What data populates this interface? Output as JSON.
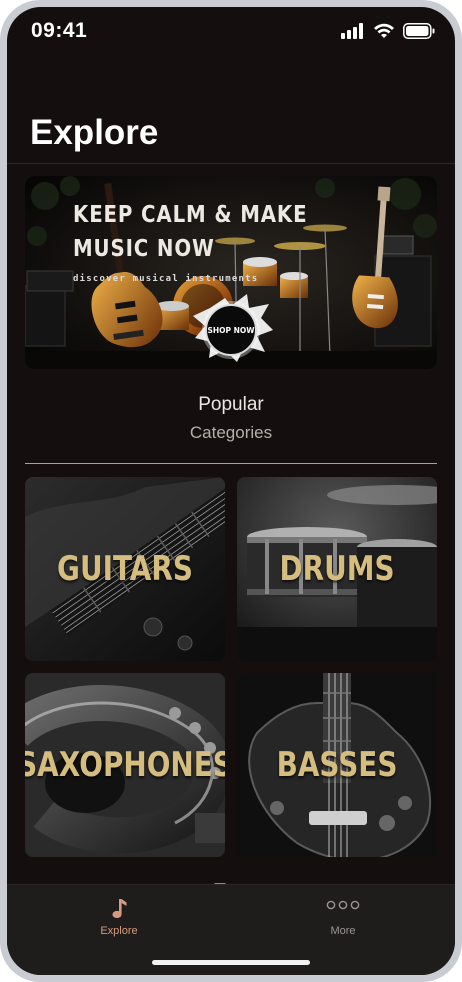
{
  "status_bar": {
    "time": "09:41",
    "icons": [
      "signal-icon",
      "wifi-icon",
      "battery-icon"
    ]
  },
  "header": {
    "title": "Explore"
  },
  "banner": {
    "headline_line1": "KEEP CALM & MAKE",
    "headline_line2": "MUSIC NOW",
    "subtitle": "discover musical instruments",
    "cta_label": "SHOP NOW"
  },
  "section": {
    "title": "Popular",
    "subtitle": "Categories"
  },
  "categories": [
    {
      "label": "GUITARS"
    },
    {
      "label": "DRUMS"
    },
    {
      "label": "SAXOPHONES"
    },
    {
      "label": "BASSES"
    }
  ],
  "tab_bar": {
    "tabs": [
      {
        "label": "Explore",
        "icon": "music-note-icon",
        "active": true
      },
      {
        "label": "More",
        "icon": "more-dots-icon",
        "active": false
      }
    ]
  },
  "colors": {
    "background": "#140f0e",
    "accent": "#d79a80",
    "category_text": "#d4bd7e",
    "divider_accent": "#c89c69"
  }
}
